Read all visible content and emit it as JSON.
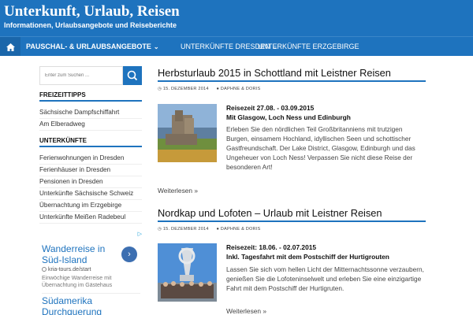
{
  "site": {
    "title": "Unterkunft, Urlaub, Reisen",
    "description": "Informationen, Urlaubsangebote und Reiseberichte"
  },
  "nav": {
    "home_icon": "home-icon",
    "items": [
      {
        "label": "PAUSCHAL- & URLAUBSANGEBOTE",
        "icon": "chevron-down-icon"
      },
      {
        "label": "UNTERKÜNFTE DRESDEN",
        "icon": "chevron-down-icon"
      },
      {
        "label": "UNTERKÜNFTE ERZGEBIRGE"
      }
    ]
  },
  "sidebar": {
    "search_placeholder": "Enter zum Suchen ...",
    "search_icon": "search-icon",
    "widgets": [
      {
        "title": "FREIZEITTIPPS",
        "links": [
          "Sächsische Dampfschiffahrt",
          "Am Elberadweg"
        ]
      },
      {
        "title": "UNTERKÜNFTE",
        "links": [
          "Ferienwohnungen in Dresden",
          "Ferienhäuser in Dresden",
          "Pensionen in Dresden",
          "Unterkünfte Sächsische Schweiz",
          "Übernachtung im Erzgebirge",
          "Unterkünfte Meißen Radebeul"
        ]
      }
    ],
    "ad": {
      "title": "Wanderreise in Süd-Island",
      "url": "kria-tours.de/start",
      "text": "Einwöchige Wanderreise mit Übernachtung im Gästehaus",
      "title2": "Südamerika Durchquerung"
    }
  },
  "posts": [
    {
      "title": "Herbsturlaub 2015 in Schottland mit Leistner Reisen",
      "date": "15. DEZEMBER 2014",
      "author": "DAPHNE & DORIS",
      "line1": "Reisezeit 27.08. - 03.09.2015",
      "line2": "Mit Glasgow, Loch Ness und Edinburgh",
      "excerpt": "Erleben Sie den nördlichen Teil Großbritanniens mit trutzigen Burgen, einsamem Hochland, idyllischen Seen und schottischer Gastfreundschaft. Der Lake District, Glasgow, Edinburgh und das Ungeheuer von Loch Ness! Verpassen Sie nicht diese Reise der besonderen Art!",
      "more": "Weiterlesen »"
    },
    {
      "title": "Nordkap und Lofoten – Urlaub mit Leistner Reisen",
      "date": "15. DEZEMBER 2014",
      "author": "DAPHNE & DORIS",
      "line1": "Reisezeit: 18.06. - 02.07.2015",
      "line2": "Inkl. Tagesfahrt mit dem Postschiff der Hurtigrouten",
      "excerpt": "Lassen Sie sich vom hellen Licht der Mitternachtssonne verzaubern, genießen Sie die Lofoteninselwelt und erleben Sie eine einzigartige Fahrt mit dem Postschiff der Hurtigruten.",
      "more": "Weiterlesen »"
    }
  ],
  "icons": {
    "date": "clock-icon",
    "author": "user-icon",
    "ad_choices": "adchoices-icon",
    "ad_arrow": "chevron-right-icon"
  },
  "colors": {
    "brand": "#1e73be",
    "ad_title": "#1e73be"
  }
}
